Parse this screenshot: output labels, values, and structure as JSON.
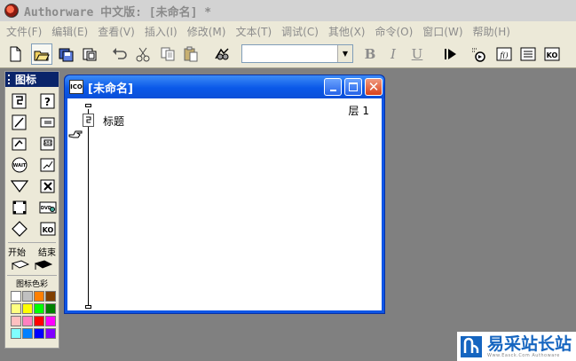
{
  "app": {
    "title": "Authorware 中文版: [未命名] *"
  },
  "menu": [
    "文件(F)",
    "编辑(E)",
    "查看(V)",
    "插入(I)",
    "修改(M)",
    "文本(T)",
    "调试(C)",
    "其他(X)",
    "命令(O)",
    "窗口(W)",
    "帮助(H)"
  ],
  "toolbar": {
    "bold": "B",
    "italic": "I",
    "underline": "U",
    "font_combo_value": "",
    "icons": [
      "new-file-icon",
      "open-file-icon",
      "save-all-icon",
      "import-icon",
      "undo-icon",
      "cut-icon",
      "copy-icon",
      "paste-icon",
      "find-icon",
      "run-icon",
      "control-panel-icon",
      "functions-icon",
      "variables-icon",
      "knowledge-objects-icon"
    ]
  },
  "palette": {
    "title": "图标",
    "icons": [
      "display-icon",
      "interaction-icon",
      "calculation-icon",
      "decision-icon",
      "motion-icon",
      "navigate-icon",
      "erase-icon",
      "framework-icon",
      "wait-icon",
      "map-icon",
      "digital-movie-icon",
      "sound-icon",
      "video-icon",
      "knowledge-object-icon"
    ],
    "wait_text": "WAIT",
    "dvd_text": "DVD",
    "ko_text": "KO",
    "start_label": "开始",
    "end_label": "结束",
    "colors_label": "图标色彩",
    "swatches": [
      "#ffffff",
      "#c0c0c0",
      "#ff8000",
      "#804000",
      "#ffff80",
      "#ffff00",
      "#00ff00",
      "#008000",
      "#ffc0c0",
      "#ff80c0",
      "#ff0000",
      "#ff00ff",
      "#80ffff",
      "#0080ff",
      "#0000ff",
      "#8000ff"
    ]
  },
  "document": {
    "title": "[未命名]",
    "layer_label": "层 1",
    "icon_label": "标题",
    "window_icon_text": "ICO"
  },
  "watermark": {
    "text": "易采站长站",
    "sub": "Www.Easck.Com  Authoware"
  },
  "colors": {
    "title_blue": "#0a58e8",
    "palette_head": "#0a246a",
    "close_red": "#d9411b",
    "desktop": "#808080"
  }
}
